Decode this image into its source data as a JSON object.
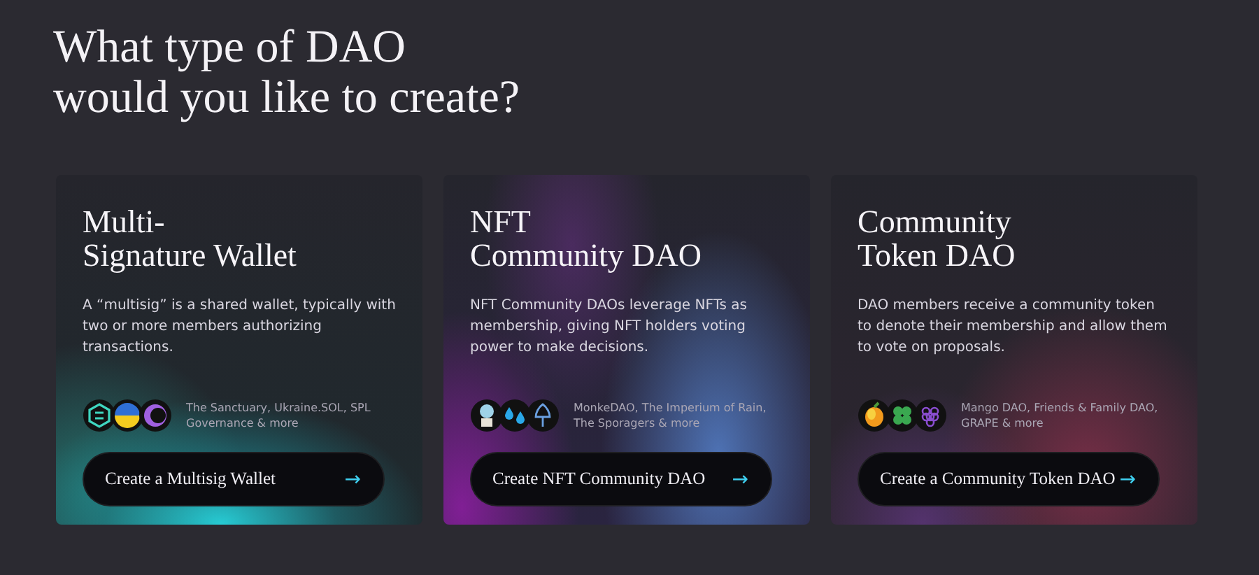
{
  "heading": {
    "lines": [
      "What type of DAO",
      "would you like to create?"
    ]
  },
  "cards": [
    {
      "kind": "multisig",
      "title_lines": [
        "Multi-",
        "Signature Wallet"
      ],
      "description": "A “multisig” is a shared wallet, typically with two or more members authorizing transactions.",
      "examples": "The Sanctuary, Ukraine.SOL, SPL Governance & more",
      "button": "Create a Multisig Wallet",
      "arrow": "→"
    },
    {
      "kind": "nft",
      "title_lines": [
        "NFT",
        "Community DAO"
      ],
      "description": "NFT Community DAOs leverage NFTs as membership, giving NFT holders voting power to make decisions.",
      "examples": "MonkeDAO, The Imperium of Rain, The Sporagers & more",
      "button": "Create NFT Community DAO",
      "arrow": "→"
    },
    {
      "kind": "token",
      "title_lines": [
        "Community",
        "Token DAO"
      ],
      "description": "DAO members receive a community token to denote their membership and allow them to vote on proposals.",
      "examples": "Mango DAO, Friends & Family DAO, GRAPE & more",
      "button": "Create a Community Token DAO",
      "arrow": "→"
    }
  ]
}
